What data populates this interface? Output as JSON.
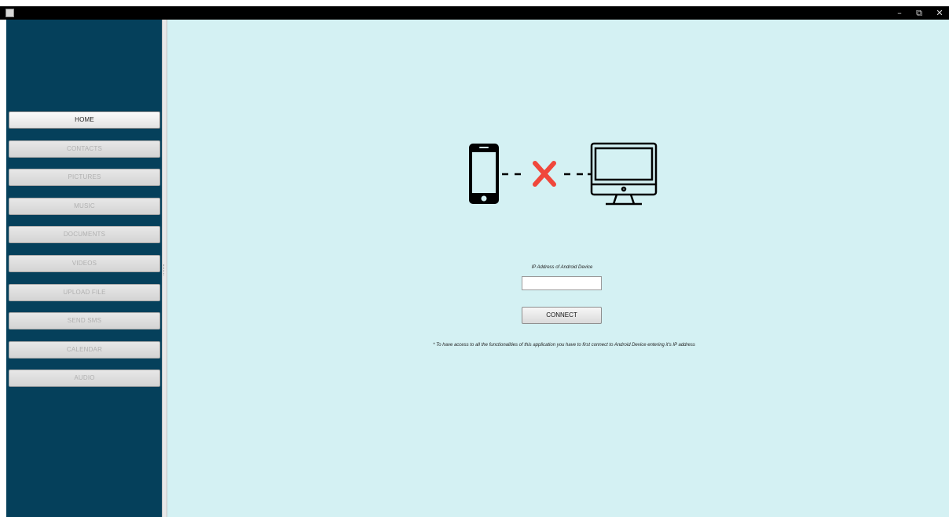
{
  "window": {
    "icon": "java-app-icon",
    "controls": {
      "minimize": "–",
      "maximize": "⧉",
      "close": "✕"
    }
  },
  "sidebar": {
    "items": [
      {
        "label": "HOME",
        "active": true
      },
      {
        "label": "CONTACTS",
        "active": false
      },
      {
        "label": "PICTURES",
        "active": false
      },
      {
        "label": "MUSIC",
        "active": false
      },
      {
        "label": "DOCUMENTS",
        "active": false
      },
      {
        "label": "VIDEOS",
        "active": false
      },
      {
        "label": "UPLOAD FILE",
        "active": false
      },
      {
        "label": "SEND SMS",
        "active": false
      },
      {
        "label": "CALENDAR",
        "active": false
      },
      {
        "label": "AUDIO",
        "active": false
      }
    ]
  },
  "main": {
    "illustration": {
      "left_icon": "smartphone-icon",
      "middle_icon": "disconnected-x-icon",
      "right_icon": "monitor-icon"
    },
    "ip_label": "IP Address of Android Device",
    "ip_value": "",
    "connect_label": "CONNECT",
    "note": "* To have access to all the functionalities of this application you have to first connect to Android Device entering it's IP address"
  },
  "colors": {
    "sidebar_bg": "#05405b",
    "main_bg": "#d4f1f3",
    "x_red": "#f0473b"
  }
}
